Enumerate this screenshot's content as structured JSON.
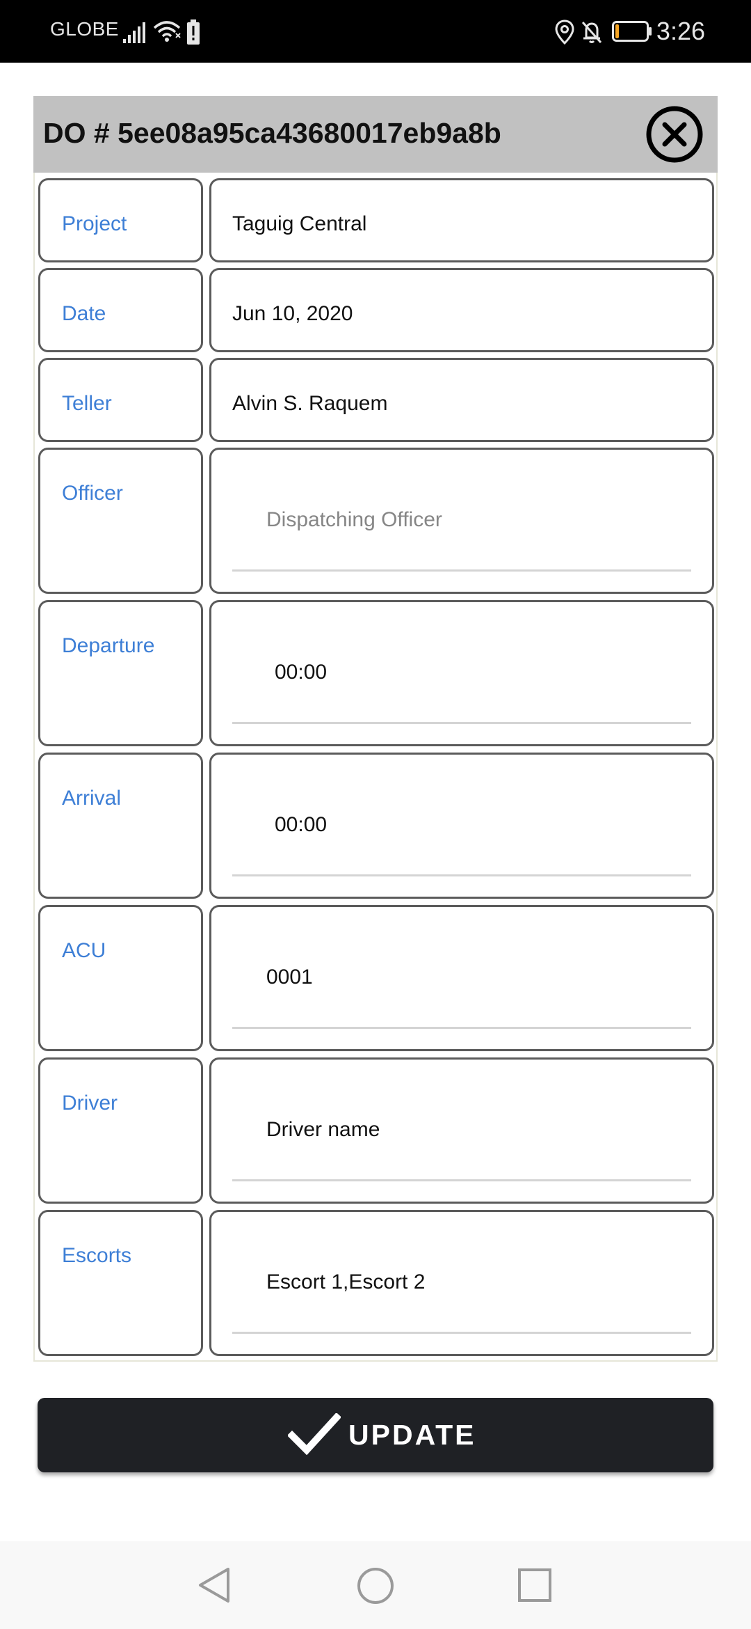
{
  "status_bar": {
    "carrier": "GLOBE",
    "time": "3:26",
    "icons": [
      "signal-icon",
      "wifi-icon",
      "battery-alert-icon",
      "location-icon",
      "notifications-off-icon",
      "battery-icon"
    ],
    "battery_level": 0.12
  },
  "dialog": {
    "title": "DO # 5ee08a95ca43680017eb9a8b",
    "close_icon": "close-circle-icon"
  },
  "form": {
    "rows": [
      {
        "label": "Project",
        "value": "Taguig Central"
      },
      {
        "label": "Date",
        "value": "Jun 10, 2020"
      },
      {
        "label": "Teller",
        "value": "Alvin S. Raquem"
      },
      {
        "label": "Officer",
        "placeholder": "Dispatching Officer",
        "value": ""
      },
      {
        "label": "Departure",
        "value": "00:00"
      },
      {
        "label": "Arrival",
        "value": "00:00"
      },
      {
        "label": "ACU",
        "value": "0001"
      },
      {
        "label": "Driver",
        "value": "Driver name"
      },
      {
        "label": "Escorts",
        "value": "Escort 1,Escort 2"
      }
    ]
  },
  "actions": {
    "update_label": "UPDATE",
    "update_icon": "check-icon"
  },
  "nav": {
    "icons": [
      "back-icon",
      "home-icon",
      "recents-icon"
    ]
  },
  "colors": {
    "label_blue": "#3e7fd6",
    "header_gray": "#c1c1c1",
    "button_dark": "#1f2125",
    "battery_orange": "#f5a524"
  }
}
